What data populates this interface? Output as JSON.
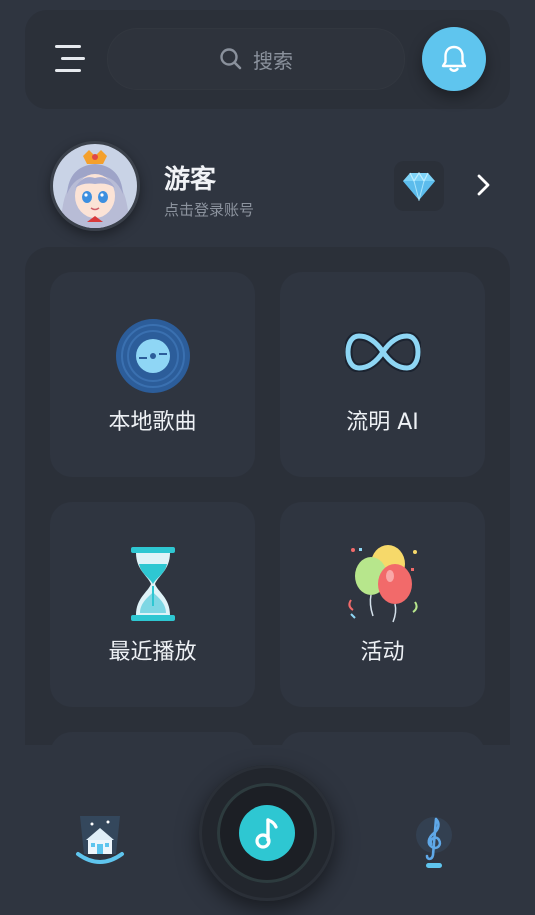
{
  "search": {
    "placeholder": "搜索"
  },
  "user": {
    "name": "游客",
    "hint": "点击登录账号"
  },
  "tiles": [
    {
      "label": "本地歌曲",
      "icon": "vinyl-record-icon"
    },
    {
      "label": "流明 AI",
      "icon": "infinity-icon"
    },
    {
      "label": "最近播放",
      "icon": "hourglass-icon"
    },
    {
      "label": "活动",
      "icon": "balloons-icon"
    }
  ],
  "icons": {
    "menu": "menu-icon",
    "search": "search-icon",
    "bell": "bell-icon",
    "vip": "diamond-icon",
    "chevron": "chevron-right-icon",
    "home": "home-icon",
    "play": "music-note-icon",
    "library": "treble-clef-icon"
  },
  "colors": {
    "background": "#2f3540",
    "card": "#2b3039",
    "accent": "#5fc5ee",
    "play": "#2ec7d2"
  }
}
